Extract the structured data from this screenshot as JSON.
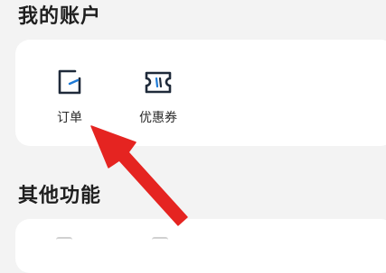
{
  "account_section": {
    "title": "我的账户",
    "items": [
      {
        "label": "订单",
        "icon": "order-icon"
      },
      {
        "label": "优惠券",
        "icon": "coupon-icon"
      }
    ]
  },
  "other_section": {
    "title": "其他功能"
  },
  "colors": {
    "background": "#f3f3f3",
    "card": "#ffffff",
    "icon_stroke": "#1f2a3a",
    "icon_accent": "#1e7ad6",
    "arrow": "#e52421"
  }
}
